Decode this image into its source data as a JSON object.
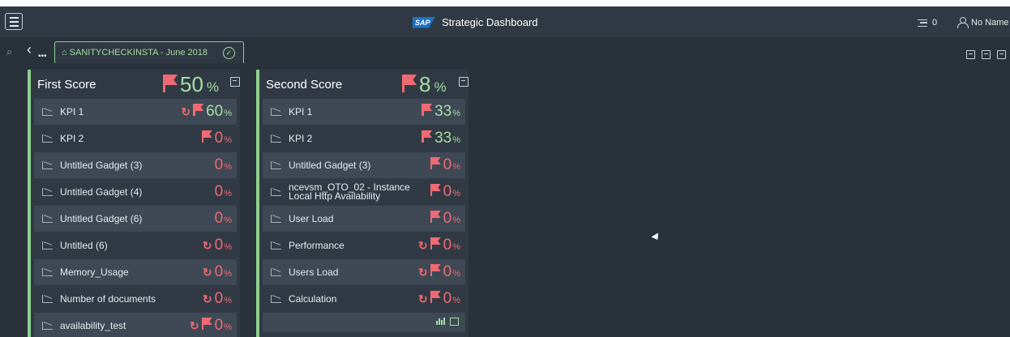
{
  "header": {
    "logo_text": "SAP",
    "title": "Strategic Dashboard",
    "notifications_count": "0",
    "user_name": "No Name"
  },
  "tabbar": {
    "back_icon": "chevron-left-icon",
    "more_icon": "more-dots-icon",
    "dots": "•••",
    "tab_label": "SANITYCHECKINSTA - June 2018"
  },
  "colors": {
    "good": "#a6dda6",
    "bad": "#f06a73",
    "accent_border": "#8ed08e"
  },
  "first_card": {
    "title": "First Score",
    "score": "50",
    "unit": "%",
    "kpis": [
      {
        "label": "KPI 1",
        "value": "60",
        "unit": "%",
        "status": "green",
        "trend": true,
        "flag": true
      },
      {
        "label": "KPI 2",
        "value": "0",
        "unit": "%",
        "status": "red",
        "trend": false,
        "flag": true
      },
      {
        "label": "Untitled Gadget (3)",
        "value": "0",
        "unit": "%",
        "status": "red",
        "trend": false,
        "flag": false
      },
      {
        "label": "Untitled Gadget (4)",
        "value": "0",
        "unit": "%",
        "status": "red",
        "trend": false,
        "flag": false
      },
      {
        "label": "Untitled Gadget (6)",
        "value": "0",
        "unit": "%",
        "status": "red",
        "trend": false,
        "flag": false
      },
      {
        "label": "Untitled (6)",
        "value": "0",
        "unit": "%",
        "status": "red",
        "trend": true,
        "flag": false
      },
      {
        "label": "Memory_Usage",
        "value": "0",
        "unit": "%",
        "status": "red",
        "trend": true,
        "flag": false
      },
      {
        "label": "Number of documents",
        "value": "0",
        "unit": "%",
        "status": "red",
        "trend": true,
        "flag": false
      },
      {
        "label": "availability_test",
        "value": "0",
        "unit": "%",
        "status": "red",
        "trend": true,
        "flag": true
      }
    ]
  },
  "second_card": {
    "title": "Second Score",
    "score": "8",
    "unit": "%",
    "kpis": [
      {
        "label": "KPI 1",
        "value": "33",
        "unit": "%",
        "status": "green",
        "trend": false,
        "flag": true
      },
      {
        "label": "KPI 2",
        "value": "33",
        "unit": "%",
        "status": "green",
        "trend": false,
        "flag": true
      },
      {
        "label": "Untitled Gadget (3)",
        "value": "0",
        "unit": "%",
        "status": "red",
        "trend": false,
        "flag": true
      },
      {
        "label": "ncevsm_OTO_02 - Instance\nLocal Http Availability",
        "value": "0",
        "unit": "%",
        "status": "red",
        "trend": false,
        "flag": true
      },
      {
        "label": "User Load",
        "value": "0",
        "unit": "%",
        "status": "red",
        "trend": false,
        "flag": true
      },
      {
        "label": "Performance",
        "value": "0",
        "unit": "%",
        "status": "red",
        "trend": true,
        "flag": true
      },
      {
        "label": "Users Load",
        "value": "0",
        "unit": "%",
        "status": "red",
        "trend": true,
        "flag": true
      },
      {
        "label": "Calculation",
        "value": "0",
        "unit": "%",
        "status": "red",
        "trend": true,
        "flag": true
      }
    ]
  }
}
